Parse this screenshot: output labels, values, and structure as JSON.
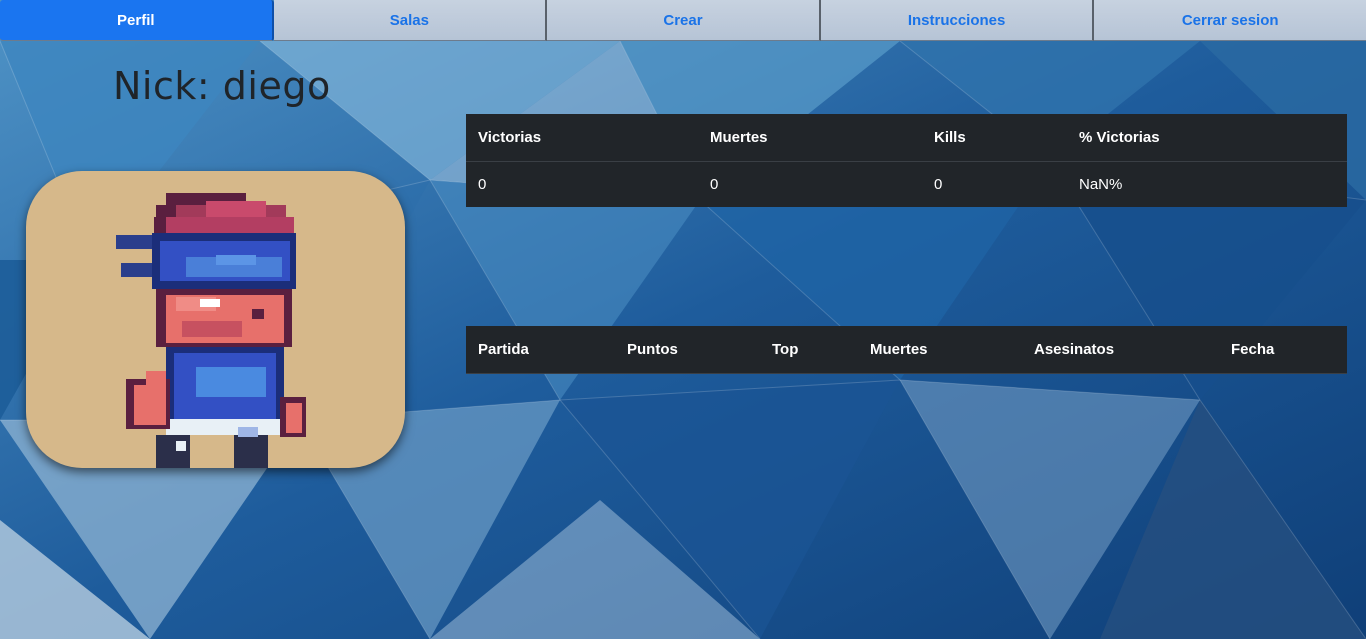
{
  "nav": {
    "items": [
      {
        "label": "Perfil",
        "active": true
      },
      {
        "label": "Salas",
        "active": false
      },
      {
        "label": "Crear",
        "active": false
      },
      {
        "label": "Instrucciones",
        "active": false
      },
      {
        "label": "Cerrar sesion",
        "active": false
      }
    ]
  },
  "profile": {
    "title": "Nick: diego",
    "avatar_icon": "pixel-ninja-character"
  },
  "stats_table": {
    "headers": [
      "Victorias",
      "Muertes",
      "Kills",
      "% Victorias"
    ],
    "row": [
      "0",
      "0",
      "0",
      "NaN%"
    ]
  },
  "matches_table": {
    "headers": [
      "Partida",
      "Puntos",
      "Top",
      "Muertes",
      "Asesinatos",
      "Fecha"
    ],
    "rows": []
  },
  "colors": {
    "accent": "#1a75f0",
    "nav_text": "#1a73e8",
    "table_bg": "#212529",
    "avatar_bg": "#d6b88a"
  }
}
